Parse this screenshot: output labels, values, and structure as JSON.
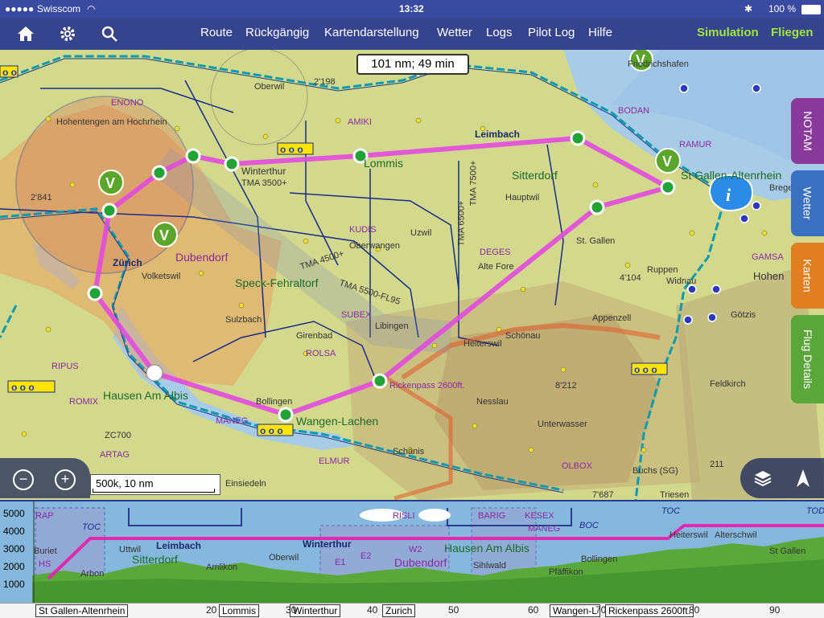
{
  "status": {
    "carrier": "Swisscom",
    "time": "13:32",
    "battery": "100 %"
  },
  "nav": {
    "menu": [
      "Route",
      "Rückgängig",
      "Kartendarstellung",
      "Wetter",
      "Logs",
      "Pilot Log",
      "Hilfe"
    ],
    "simulation": "Simulation",
    "fly": "Fliegen"
  },
  "route_info": "101 nm; 49 min",
  "scale": "500k, 10 nm",
  "side_tabs": [
    "NOTAM",
    "Wetter",
    "Karten",
    "Flug Details"
  ],
  "map_labels": {
    "lommis": "Lommis",
    "winterthur": "Winterthur",
    "sitterdorf": "Sitterdorf",
    "leimbach": "Leimbach",
    "st_gallen": "St Gallen-Altenrhein",
    "zurich": "Zurich",
    "dubendorf": "Dubendorf",
    "speck": "Speck-Fehraltorf",
    "hausen": "Hausen Am Albis",
    "wangen": "Wangen-Lachen",
    "rickenpass": "Rickenpass 2600ft.",
    "tma3500": "TMA 3500+",
    "tma4500": "TMA 4500+",
    "tma5500": "TMA 5500-FL95",
    "tma7500": "TMA 7500+",
    "tma6500": "TMA 6500+",
    "enono": "ENONO",
    "amiki": "AMIKI",
    "kudis": "KUDIS",
    "deges": "DEGES",
    "subex": "SUBEX",
    "rolsa": "ROLSA",
    "elmur": "ELMUR",
    "olbox": "OLBOX",
    "bodan": "BODAN",
    "ramur": "RAMUR",
    "gamsa": "GAMSA",
    "ripus": "RIPUS",
    "romix": "ROMIX",
    "artag": "ARTAG",
    "zc700": "ZC700",
    "maneg": "MANEG",
    "appenzell": "Appenzell",
    "heiterswil": "Heiterswil",
    "nesslau": "Nesslau",
    "unterwasser": "Unterwasser",
    "schanis": "Schänis",
    "einsiedeln": "Einsiedeln",
    "libingen": "Libingen",
    "uzwil": "Uzwil",
    "hauptwil": "Hauptwil",
    "altefore": "Alte Fore",
    "oberwangen": "Oberwangen",
    "widnau": "Widnau",
    "hohenems": "Hohen",
    "gotzis": "Götzis",
    "feldkirch": "Feldkirch",
    "buchs": "Buchs (SG)",
    "triesen": "Triesen",
    "schonau": "Schönau",
    "ruppen": "Ruppen",
    "elev_2198": "2'198",
    "elev_2841": "2'841",
    "elev_4104": "4'104",
    "elev_8212": "8'212",
    "elev_7687": "7'687",
    "elev_211": "211",
    "hohentengen": "Hohentengen am Hochrhein",
    "zurich_city": "Zürich",
    "volketswil": "Volketswil",
    "sulzbach": "Sulzbach",
    "girenbad": "Girenbad",
    "oberwil": "Oberwil",
    "rollingen": "Bollingen",
    "friedrichshafen": "Friedrichshafen",
    "bregenz": "Brege",
    "stgallen_city": "St. Gallen"
  },
  "profile": {
    "alt_labels": [
      "5000",
      "4000",
      "3000",
      "2000",
      "1000"
    ],
    "labels": [
      "RAP",
      "TOC",
      "Buriet",
      "Uttwil",
      "Leimbach",
      "Sitterdorf",
      "Arbon",
      "Amlikon",
      "Oberwil",
      "Winterthur",
      "E1",
      "E2",
      "W2",
      "Dubendorf",
      "RISLI",
      "Hausen Am Albis",
      "BARIG",
      "KESEX",
      "MANEG",
      "BOC",
      "TOC",
      "Heiterswil",
      "Alterschwil",
      "Bollingen",
      "Pfäffikon",
      "Sihlwald",
      "St Gallen",
      "TOD",
      "HS"
    ]
  },
  "waypoints": [
    "St Gallen-Altenrhein",
    "Lommis",
    "Winterthur",
    "Zurich",
    "Wangen-L",
    "Rickenpass 2600ft."
  ],
  "distance_ticks": [
    "20",
    "30",
    "40",
    "50",
    "60",
    "70",
    "80",
    "90"
  ]
}
